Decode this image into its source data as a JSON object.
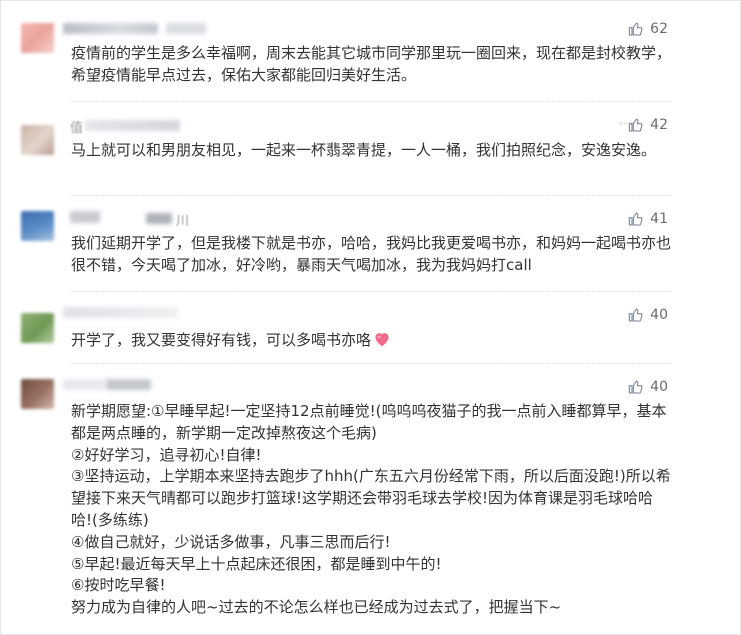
{
  "comments": [
    {
      "likes": "62",
      "text": "疫情前的学生是多么幸福啊，周末去能其它城市同学那里玩一圈回来，现在都是封校教学，希望疫情能早点过去，保佑大家都能回归美好生活。"
    },
    {
      "likes": "42",
      "name_fragment": "值",
      "text": "马上就可以和男朋友相见，一起来一杯翡翠青提，一人一桶，我们拍照纪念，安逸安逸。"
    },
    {
      "likes": "41",
      "name_fragment": "川",
      "text": "我们延期开学了，但是我楼下就是书亦，哈哈，我妈比我更爱喝书亦，和妈妈一起喝书亦也很不错，今天喝了加冰，好冷哟，暴雨天气喝加冰，我为我妈妈打call"
    },
    {
      "likes": "40",
      "text": "开学了，我又要变得好有钱，可以多喝书亦咯"
    },
    {
      "likes": "40",
      "text": "新学期愿望:①早睡早起!一定坚持12点前睡觉!(呜呜呜夜猫子的我一点前入睡都算早，基本都是两点睡的，新学期一定改掉熬夜这个毛病)\n②好好学习，追寻初心!自律!\n③坚持运动，上学期本来坚持去跑步了hhh(广东五六月份经常下雨，所以后面没跑!)所以希望接下来天气晴都可以跑步打篮球!这学期还会带羽毛球去学校!因为体育课是羽毛球哈哈哈!(多练练)\n④做自己就好，少说话多做事，凡事三思而后行!\n⑤早起!最近每天早上十点起床还很困，都是睡到中午的!\n⑥按时吃早餐!\n努力成为自律的人吧~过去的不论怎么样也已经成为过去式了，把握当下~"
    }
  ],
  "icons": {
    "like": "thumbs-up-icon",
    "more": "more-dots-icon",
    "emoji": "heart-emoji"
  },
  "colors": {
    "text": "#333333",
    "meta": "#6b6b6b",
    "heart": "#f06a8a"
  }
}
